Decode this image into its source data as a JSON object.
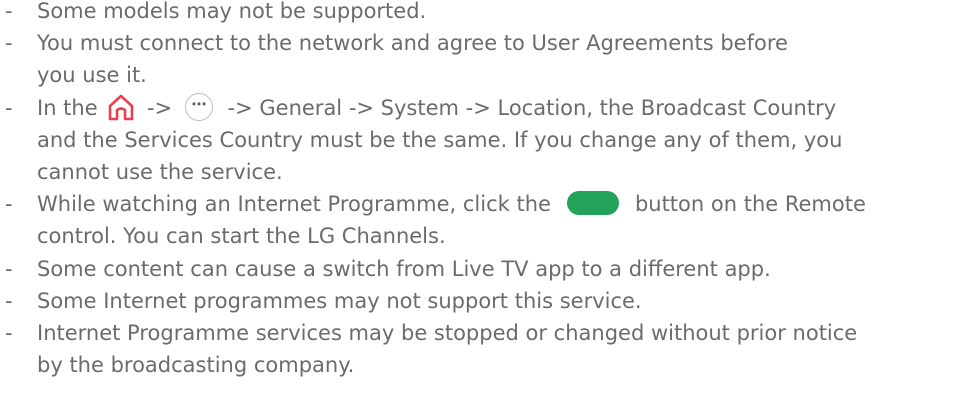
{
  "colors": {
    "home_icon": "#ee3d4e",
    "green_button": "#23a35a",
    "text": "#6b6b6b"
  },
  "notes": {
    "dash": "-",
    "n1": {
      "lines": [
        "Some models may not be supported."
      ]
    },
    "n2": {
      "lines": [
        "You must connect to the network and agree to User Agreements before",
        "you use it."
      ]
    },
    "n3": {
      "before_home": "In the ",
      "home_icon": "home-icon",
      "arrow1": " -> ",
      "more_icon": "more-icon",
      "more_glyph": "⋯",
      "after_more": " -> General -> System -> Location, the Broadcast Country",
      "lines": [
        "and the Services Country must be the same. If you change any of them, you",
        "cannot use the service."
      ]
    },
    "n4": {
      "before_button": "While watching an Internet Programme, click the",
      "button_icon": "green-button",
      "after_button": "button on the Remote",
      "lines": [
        "control. You can start the LG Channels."
      ]
    },
    "n5": {
      "lines": [
        "Some content can cause a switch from Live TV app to a different app."
      ]
    },
    "n6": {
      "lines": [
        "Some Internet programmes may not support this service."
      ]
    },
    "n7": {
      "lines": [
        "Internet Programme services may be stopped or changed without prior notice",
        "by the broadcasting company."
      ]
    }
  }
}
